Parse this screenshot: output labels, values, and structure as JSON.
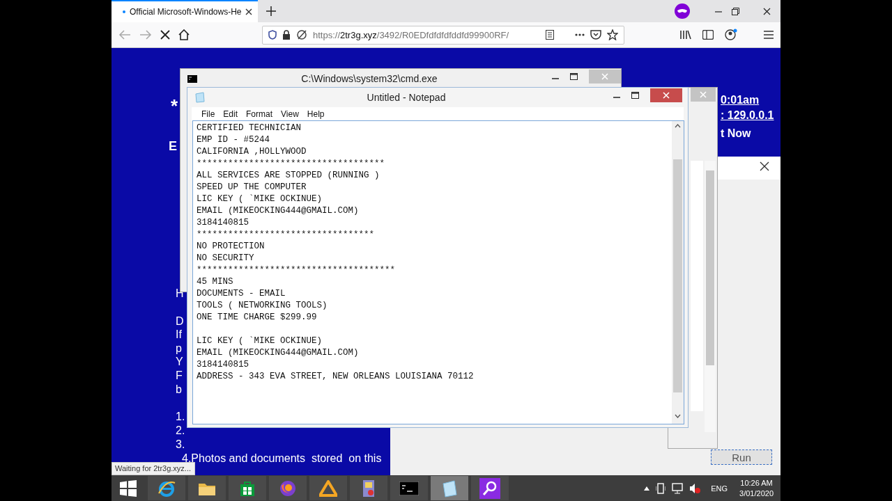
{
  "browser": {
    "tab": {
      "title": "Official Microsoft-Windows-He",
      "selected": true
    },
    "url": {
      "scheme": "https://",
      "host": "2tr3g.xyz",
      "path": "/3492/R0EDfdfdfdfddfd99900RF/"
    },
    "status": "Waiting for 2tr3g.xyz..."
  },
  "page": {
    "left_fragments": [
      "*",
      "E",
      "H",
      "D",
      "If",
      "p",
      "Y",
      "F",
      "b",
      "1.",
      "2.",
      "3.",
      "4.Photos and documents  stored  on this"
    ],
    "right_fragments": [
      {
        "text": "0:01am",
        "kind": "link"
      },
      {
        "text": ": 129.0.0.1",
        "kind": "link"
      },
      {
        "text": "t Now",
        "kind": "text"
      }
    ]
  },
  "dialog": {
    "button": "Run"
  },
  "cmd_window": {
    "title": "C:\\Windows\\system32\\cmd.exe"
  },
  "notepad": {
    "title": "Untitled - Notepad",
    "menu": [
      "File",
      "Edit",
      "Format",
      "View",
      "Help"
    ],
    "paragraphs": [
      [
        "CERTIFIED TECHNICIAN",
        "EMP ID - #5244",
        "CALIFORNIA ,HOLLYWOOD",
        "************************************",
        "ALL SERVICES ARE STOPPED (RUNNING )",
        "SPEED UP THE COMPUTER",
        "LIC KEY ( `MIKE OCKINUE)",
        "EMAIL (MIKEOCKING444@GMAIL.COM)",
        "3184140815",
        "**********************************",
        "NO PROTECTION",
        "NO SECURITY",
        "**************************************",
        "45 MINS",
        "DOCUMENTS - EMAIL",
        "TOOLS ( NETWORKING TOOLS)",
        "ONE TIME CHARGE $299.99"
      ],
      [
        "LIC KEY ( `MIKE OCKINUE)",
        "EMAIL (MIKEOCKING444@GMAIL.COM)",
        "3184140815",
        "ADDRESS - 343 EVA STREET, NEW ORLEANS LOUISIANA 70112"
      ]
    ]
  },
  "taskbar": {
    "apps": [
      {
        "kind": "ie",
        "selected": false
      },
      {
        "kind": "folder",
        "selected": false
      },
      {
        "kind": "store",
        "selected": false
      },
      {
        "kind": "firefox",
        "selected": false
      },
      {
        "kind": "triangle",
        "selected": false
      },
      {
        "kind": "security",
        "selected": false
      },
      {
        "kind": "cmd",
        "selected": false
      },
      {
        "kind": "notepad",
        "selected": true
      },
      {
        "kind": "search",
        "selected": false
      }
    ],
    "language": "ENG",
    "time": "10:26 AM",
    "date": "3/01/2020"
  }
}
